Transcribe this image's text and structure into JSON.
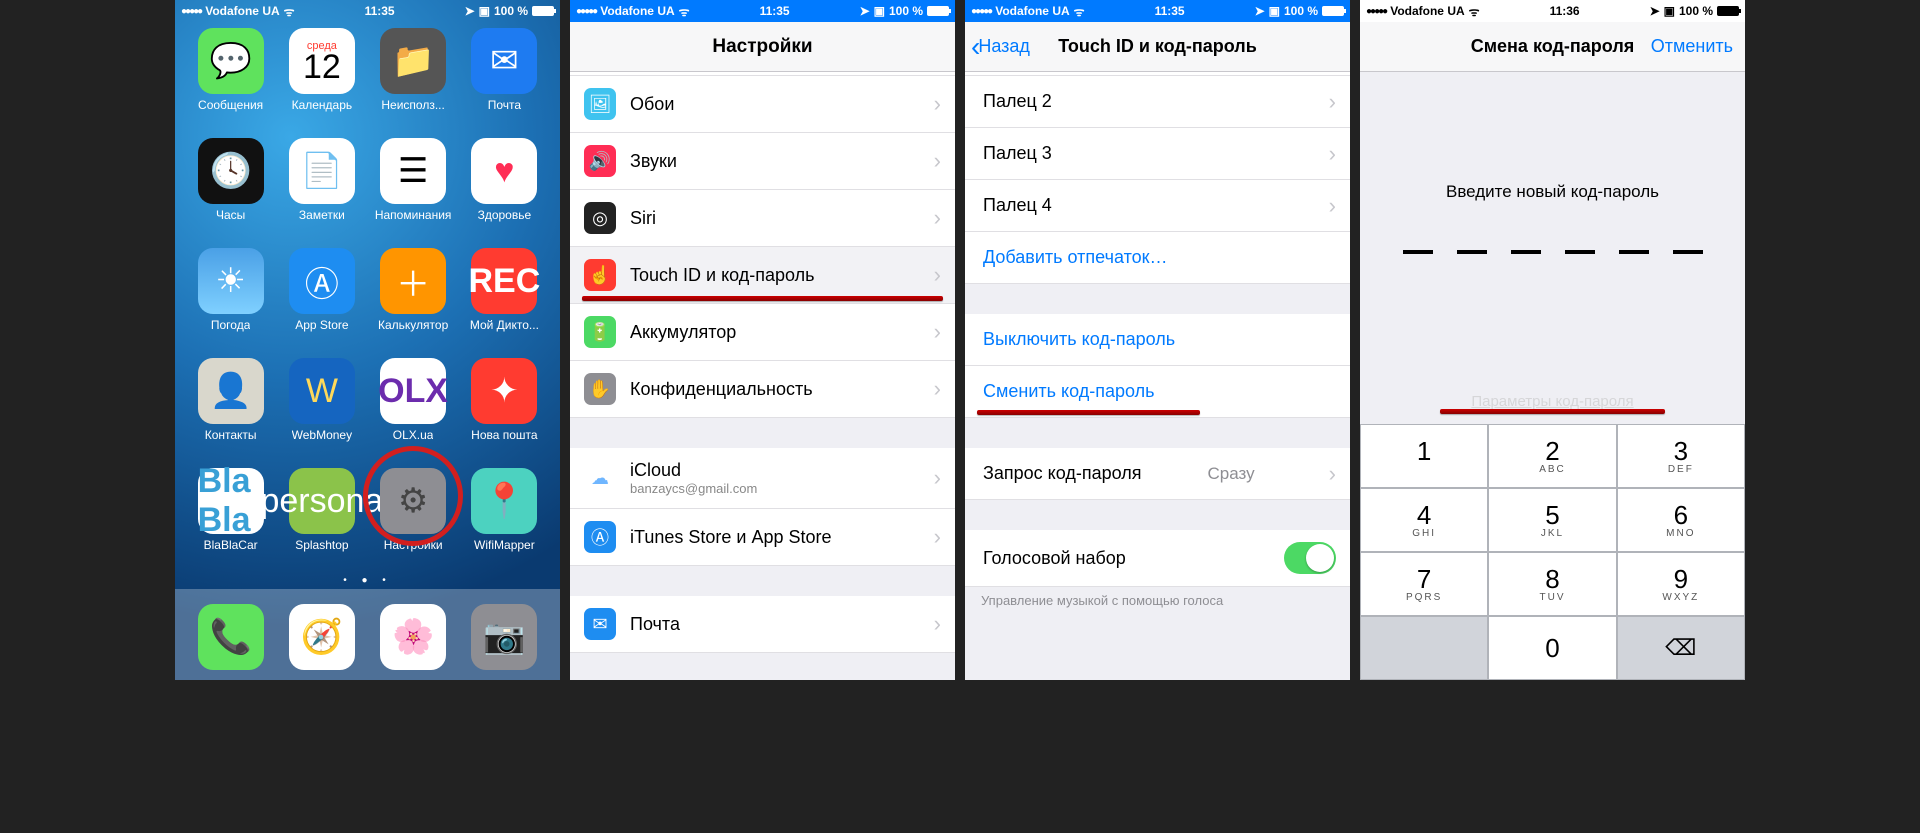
{
  "status": {
    "carrier": "Vodafone UA",
    "time_a": "11:35",
    "time_b": "11:36",
    "battery": "100 %"
  },
  "panel1": {
    "calendar_weekday": "среда",
    "calendar_day": "12",
    "apps": [
      {
        "label": "Сообщения",
        "name": "messages-icon",
        "cls": "ic-messages",
        "glyph": "💬"
      },
      {
        "label": "Календарь",
        "name": "calendar-icon",
        "cls": "ic-calendar",
        "glyph": ""
      },
      {
        "label": "Неисполз...",
        "name": "unused-folder-icon",
        "cls": "ic-folder",
        "glyph": "📁"
      },
      {
        "label": "Почта",
        "name": "mail-icon",
        "cls": "ic-mail",
        "glyph": "✉"
      },
      {
        "label": "Часы",
        "name": "clock-icon",
        "cls": "ic-clock",
        "glyph": "🕓"
      },
      {
        "label": "Заметки",
        "name": "notes-icon",
        "cls": "ic-notes",
        "glyph": "📄"
      },
      {
        "label": "Напоминания",
        "name": "reminders-icon",
        "cls": "ic-reminders",
        "glyph": "☰"
      },
      {
        "label": "Здоровье",
        "name": "health-icon",
        "cls": "ic-health",
        "glyph": "♥"
      },
      {
        "label": "Погода",
        "name": "weather-icon",
        "cls": "ic-weather",
        "glyph": "☀"
      },
      {
        "label": "App Store",
        "name": "appstore-icon",
        "cls": "ic-appstore",
        "glyph": "Ⓐ"
      },
      {
        "label": "Калькулятор",
        "name": "calculator-icon",
        "cls": "ic-calc",
        "glyph": "＋"
      },
      {
        "label": "Мой Дикто...",
        "name": "recorder-icon",
        "cls": "ic-rec",
        "glyph": "REC"
      },
      {
        "label": "Контакты",
        "name": "contacts-icon",
        "cls": "ic-contacts",
        "glyph": "👤"
      },
      {
        "label": "WebMoney",
        "name": "webmoney-icon",
        "cls": "ic-webmoney",
        "glyph": "W"
      },
      {
        "label": "OLX.ua",
        "name": "olx-icon",
        "cls": "ic-olx",
        "glyph": "OLX"
      },
      {
        "label": "Нова пошта",
        "name": "novaposhta-icon",
        "cls": "ic-nova",
        "glyph": "✦"
      },
      {
        "label": "BlaBlaCar",
        "name": "blablacar-icon",
        "cls": "ic-blabla",
        "glyph": "Bla\nBla"
      },
      {
        "label": "Splashtop",
        "name": "splashtop-icon",
        "cls": "ic-splash",
        "glyph": "persona"
      },
      {
        "label": "Настройки",
        "name": "settings-icon",
        "cls": "ic-settings",
        "glyph": "⚙"
      },
      {
        "label": "WifiMapper",
        "name": "wifimapper-icon",
        "cls": "ic-wifimapper",
        "glyph": "📍"
      }
    ],
    "dock": [
      {
        "label": "Телефон",
        "name": "phone-icon",
        "cls": "ic-phone",
        "glyph": "📞"
      },
      {
        "label": "Safari",
        "name": "safari-icon",
        "cls": "ic-safari",
        "glyph": "🧭"
      },
      {
        "label": "Фото",
        "name": "photos-icon",
        "cls": "ic-photos",
        "glyph": "🌸"
      },
      {
        "label": "Камера",
        "name": "camera-icon",
        "cls": "ic-camera",
        "glyph": "📷"
      }
    ]
  },
  "panel2": {
    "title": "Настройки",
    "rows": {
      "wallpaper": {
        "label": "Обои",
        "icon_bg": "#3fc3ef"
      },
      "sounds": {
        "label": "Звуки",
        "icon_bg": "#ff2d55"
      },
      "siri": {
        "label": "Siri",
        "icon_bg": "#222"
      },
      "touchid": {
        "label": "Touch ID и код-пароль",
        "icon_bg": "#ff3b30"
      },
      "battery": {
        "label": "Аккумулятор",
        "icon_bg": "#4cd964"
      },
      "privacy": {
        "label": "Конфиденциальность",
        "icon_bg": "#8e8e93"
      },
      "icloud": {
        "label": "iCloud",
        "sub": "banzaycs@gmail.com",
        "icon_bg": "#fff"
      },
      "appstore": {
        "label": "iTunes Store и App Store",
        "icon_bg": "#1e8df1"
      },
      "mailrow": {
        "label": "Почта",
        "icon_bg": "#1e8df1"
      }
    }
  },
  "panel3": {
    "back": "Назад",
    "title": "Touch ID и код-пароль",
    "finger2": "Палец 2",
    "finger3": "Палец 3",
    "finger4": "Палец 4",
    "add": "Добавить отпечаток…",
    "turnoff": "Выключить код-пароль",
    "change": "Сменить код-пароль",
    "require": "Запрос код-пароля",
    "require_value": "Сразу",
    "voice": "Голосовой набор",
    "footer": "Управление музыкой с помощью голоса"
  },
  "panel4": {
    "title": "Смена код-пароля",
    "cancel": "Отменить",
    "prompt": "Введите новый код-пароль",
    "options": "Параметры код-пароля",
    "keys": [
      {
        "n": "1",
        "l": ""
      },
      {
        "n": "2",
        "l": "ABC"
      },
      {
        "n": "3",
        "l": "DEF"
      },
      {
        "n": "4",
        "l": "GHI"
      },
      {
        "n": "5",
        "l": "JKL"
      },
      {
        "n": "6",
        "l": "MNO"
      },
      {
        "n": "7",
        "l": "PQRS"
      },
      {
        "n": "8",
        "l": "TUV"
      },
      {
        "n": "9",
        "l": "WXYZ"
      }
    ],
    "zero": {
      "n": "0",
      "l": ""
    }
  }
}
